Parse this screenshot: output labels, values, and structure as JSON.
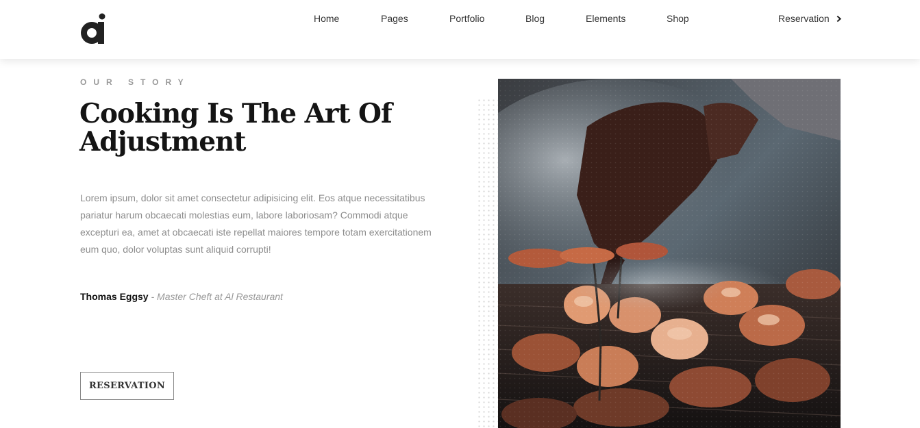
{
  "nav": {
    "items": [
      "Home",
      "Pages",
      "Portfolio",
      "Blog",
      "Elements",
      "Shop"
    ],
    "reservation_label": "Reservation"
  },
  "story": {
    "eyebrow": "OUR STORY",
    "title": "Cooking Is The Art Of Adjustment",
    "description": "Lorem ipsum, dolor sit amet consectetur adipisicing elit. Eos atque necessitatibus pariatur harum obcaecati molestias eum, labore laboriosam? Commodi atque excepturi ea, amet at obcaecati iste repellat maiores tempore totam exercitationem eum quo, dolor voluptas sunt aliquid corrupti!",
    "author_name": "Thomas Eggsy",
    "author_separator": " - ",
    "author_role": "Master Cheft at Al Restaurant",
    "button_label": "RESERVATION"
  },
  "icons": {
    "logo": "ai-logo-icon",
    "reservation": "chevron-right-icon"
  },
  "colors": {
    "heading": "#141414",
    "body_text": "#8c8c8c",
    "muted": "#999999"
  }
}
